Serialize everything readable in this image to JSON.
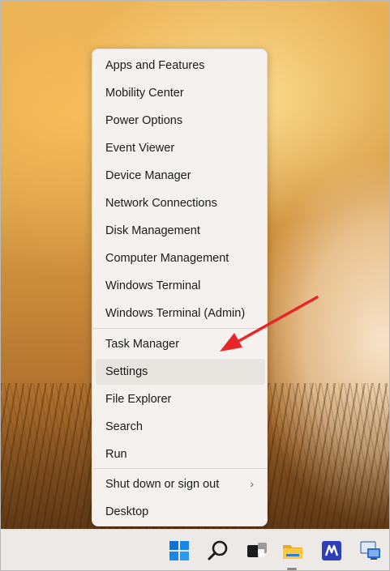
{
  "context_menu": {
    "group1": [
      {
        "label": "Apps and Features",
        "name": "apps-and-features"
      },
      {
        "label": "Mobility Center",
        "name": "mobility-center"
      },
      {
        "label": "Power Options",
        "name": "power-options"
      },
      {
        "label": "Event Viewer",
        "name": "event-viewer"
      },
      {
        "label": "Device Manager",
        "name": "device-manager"
      },
      {
        "label": "Network Connections",
        "name": "network-connections"
      },
      {
        "label": "Disk Management",
        "name": "disk-management"
      },
      {
        "label": "Computer Management",
        "name": "computer-management"
      },
      {
        "label": "Windows Terminal",
        "name": "windows-terminal"
      },
      {
        "label": "Windows Terminal (Admin)",
        "name": "windows-terminal-admin"
      }
    ],
    "group2": [
      {
        "label": "Task Manager",
        "name": "task-manager"
      },
      {
        "label": "Settings",
        "name": "settings"
      },
      {
        "label": "File Explorer",
        "name": "file-explorer"
      },
      {
        "label": "Search",
        "name": "search"
      },
      {
        "label": "Run",
        "name": "run"
      }
    ],
    "group3": [
      {
        "label": "Shut down or sign out",
        "name": "shut-down-or-sign-out",
        "submenu": true
      },
      {
        "label": "Desktop",
        "name": "desktop"
      }
    ],
    "hovered_item": "Settings",
    "submenu_glyph": "›"
  },
  "taskbar": {
    "icons": [
      "windows-start-icon",
      "search-icon",
      "task-view-icon",
      "file-explorer-icon",
      "app-icon",
      "remote-desktop-icon"
    ],
    "accent_color": "#0078d4"
  },
  "annotation": {
    "arrow_color": "#e8262a"
  }
}
